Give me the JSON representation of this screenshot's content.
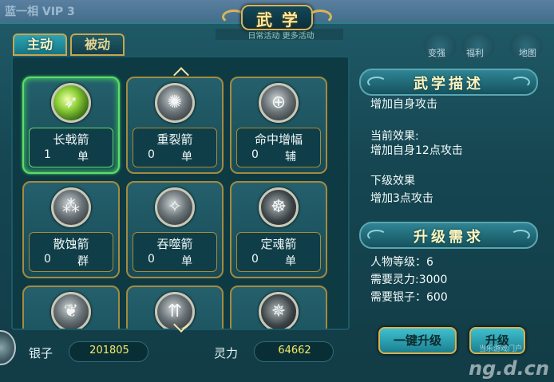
{
  "window": {
    "title": "武学",
    "subtitle": "日常活动 更多活动"
  },
  "background": {
    "hud_left": "蓝一相 VIP 3",
    "hud_buttons": [
      "变强",
      "福利",
      "地图"
    ]
  },
  "tabs": [
    {
      "label": "主动",
      "active": true
    },
    {
      "label": "被动",
      "active": false
    }
  ],
  "skills": [
    {
      "name": "长戟箭",
      "level": "1",
      "type": "单",
      "icon": "spear-arrow-icon",
      "selected": true
    },
    {
      "name": "重裂箭",
      "level": "0",
      "type": "单",
      "icon": "split-arrow-icon",
      "selected": false
    },
    {
      "name": "命中增幅",
      "level": "0",
      "type": "辅",
      "icon": "crosshair-icon",
      "selected": false
    },
    {
      "name": "散蚀箭",
      "level": "0",
      "type": "群",
      "icon": "scatter-arrow-icon",
      "selected": false
    },
    {
      "name": "吞噬箭",
      "level": "0",
      "type": "单",
      "icon": "devour-arrow-icon",
      "selected": false
    },
    {
      "name": "定魂箭",
      "level": "0",
      "type": "单",
      "icon": "soul-arrow-icon",
      "selected": false
    },
    {
      "icon": "wing-icon"
    },
    {
      "icon": "triple-arrow-icon"
    },
    {
      "icon": "dark-swirl-icon"
    }
  ],
  "description": {
    "header": "武学描述",
    "effect_text": "增加自身攻击",
    "current_label": "当前效果:",
    "current_effect": "增加自身12点攻击",
    "next_label": "下级效果",
    "next_effect": "增加3点攻击"
  },
  "requirements": {
    "header": "升级需求",
    "level": "人物等级：6",
    "spirit": "需要灵力:3000",
    "silver": "需要银子：600"
  },
  "buttons": {
    "upgrade_all": "一键升级",
    "upgrade": "升级"
  },
  "currency": {
    "silver_label": "银子",
    "silver_value": "201805",
    "spirit_label": "灵力",
    "spirit_value": "64662"
  },
  "watermark": {
    "main": "ng.d.cn",
    "sub": "当乐游戏门户"
  },
  "colors": {
    "accent_gold": "#d7b24f",
    "selected_green": "#5fdc6a",
    "value_yellow": "#f3ea66",
    "panel_teal": "#154651"
  }
}
